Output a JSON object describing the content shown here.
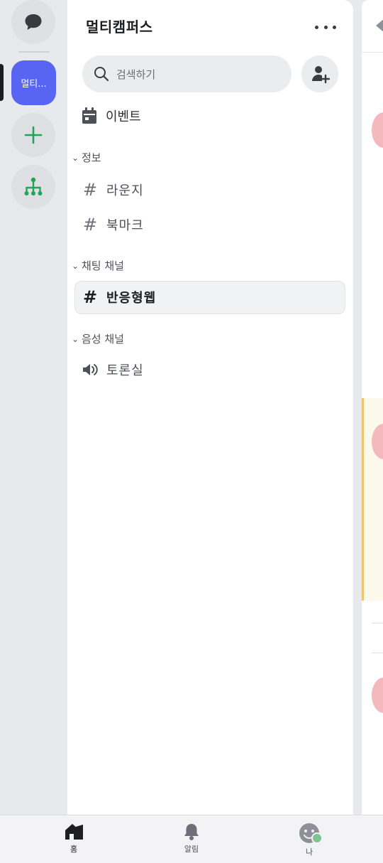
{
  "rail": {
    "server_abbrev": "멀티..."
  },
  "panel": {
    "server_name": "멀티캠퍼스",
    "search_placeholder": "검색하기",
    "events_label": "이벤트",
    "categories": [
      {
        "name": "정보",
        "channels": [
          "라운지",
          "북마크"
        ]
      },
      {
        "name": "채팅 채널",
        "channels": [
          "반응형웹"
        ]
      },
      {
        "name": "음성 채널",
        "channels": [
          "토론실"
        ]
      }
    ],
    "active_channel": "반응형웹"
  },
  "bottom_nav": {
    "home": "홈",
    "notifications": "알림",
    "me": "나"
  },
  "colors": {
    "brand": "#5865f2",
    "green_accent": "#23a559",
    "status_online": "#7dc58f"
  },
  "icons": [
    "chat-bubble-icon",
    "plus-icon",
    "hierarchy-icon",
    "search-icon",
    "add-user-icon",
    "calendar-icon",
    "hash-icon",
    "speaker-icon",
    "home-icon",
    "bell-icon",
    "smiley-icon"
  ]
}
